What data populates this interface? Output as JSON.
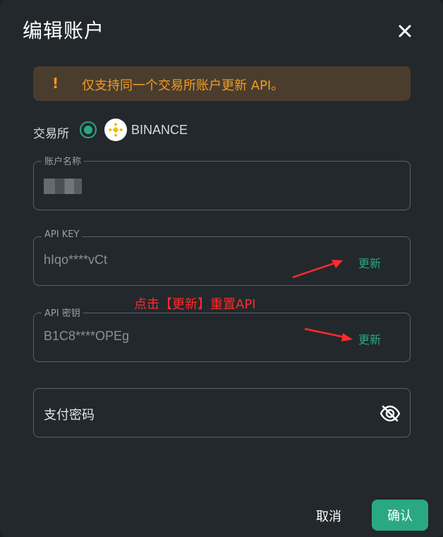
{
  "dialog": {
    "title": "编辑账户"
  },
  "warning": {
    "icon": "exclamation-icon",
    "text": "仅支持同一个交易所账户更新 API。",
    "color": "#f29b22"
  },
  "exchange": {
    "label": "交易所",
    "selected": "BINANCE",
    "accent": "#2aa882"
  },
  "fields": {
    "account_name": {
      "label": "账户名称"
    },
    "api_key": {
      "label": "API KEY",
      "value": "hIqo****vCt",
      "update_label": "更新"
    },
    "api_secret": {
      "label": "API 密钥",
      "value": "B1C8****OPEg",
      "update_label": "更新"
    },
    "payment_password": {
      "placeholder": "支付密码",
      "icon": "eye-off-icon"
    }
  },
  "annotation": {
    "text": "点击【更新】重置API",
    "color": "#ff2b2b"
  },
  "footer": {
    "cancel_label": "取消",
    "confirm_label": "确认"
  }
}
